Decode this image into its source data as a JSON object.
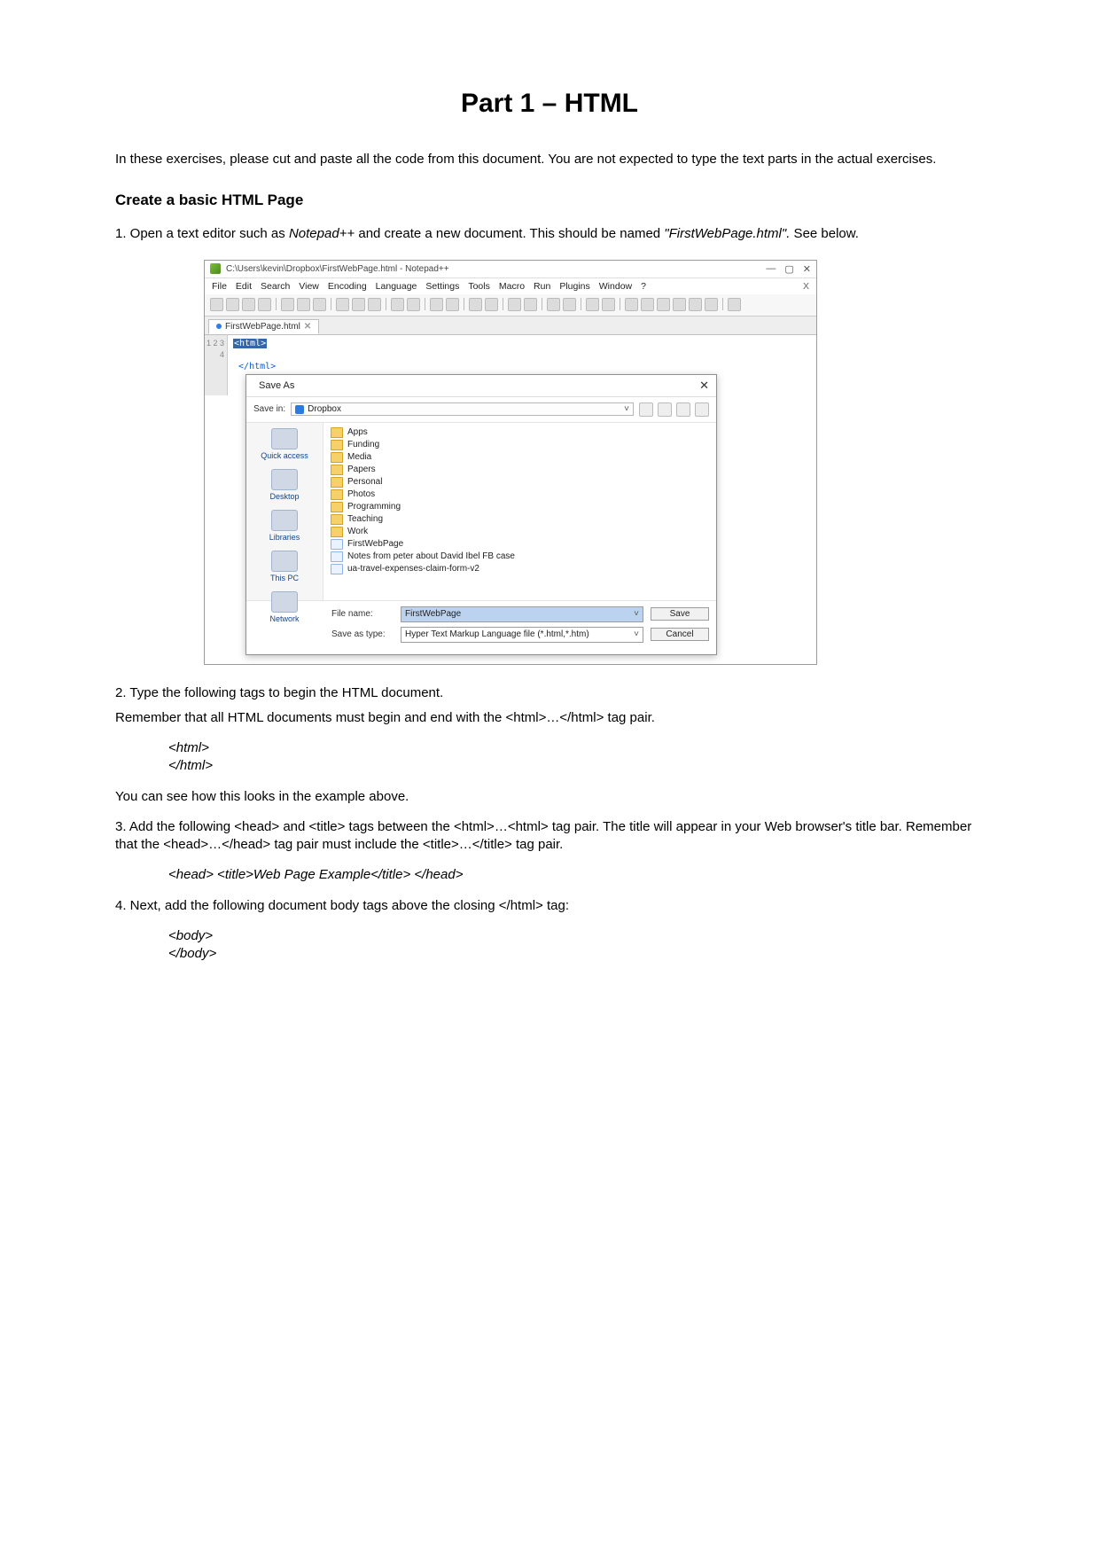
{
  "title": "Part 1 – HTML",
  "intro": "In these exercises, please cut and paste all the code from this document. You are not expected to type the text parts in the actual exercises.",
  "heading1": "Create a basic HTML Page",
  "step1_a": "1. Open a text editor such as ",
  "step1_b": "Notepad++",
  "step1_c": " and create a new document. This should be named ",
  "step1_d": "\"FirstWebPage.html\".",
  "step1_e": " See below.",
  "npp": {
    "title": "C:\\Users\\kevin\\Dropbox\\FirstWebPage.html - Notepad++",
    "win_min": "—",
    "win_max": "▢",
    "win_close": "✕",
    "menu": [
      "File",
      "Edit",
      "Search",
      "View",
      "Encoding",
      "Language",
      "Settings",
      "Tools",
      "Macro",
      "Run",
      "Plugins",
      "Window",
      "?"
    ],
    "menu_x": "X",
    "tab_label": "FirstWebPage.html",
    "tab_close": "✕",
    "gutter": "1\n2\n3\n4",
    "code_line1": "<html>",
    "code_line2": "</html>"
  },
  "saveas": {
    "title": "Save As",
    "close": "✕",
    "save_in_label": "Save in:",
    "save_in_value": "Dropbox",
    "dropdown_arrow": "˅",
    "places": [
      "Quick access",
      "Desktop",
      "Libraries",
      "This PC",
      "Network"
    ],
    "files": [
      {
        "name": "Apps",
        "type": "folder"
      },
      {
        "name": "Funding",
        "type": "folder"
      },
      {
        "name": "Media",
        "type": "folder"
      },
      {
        "name": "Papers",
        "type": "folder"
      },
      {
        "name": "Personal",
        "type": "folder"
      },
      {
        "name": "Photos",
        "type": "folder"
      },
      {
        "name": "Programming",
        "type": "folder"
      },
      {
        "name": "Teaching",
        "type": "folder"
      },
      {
        "name": "Work",
        "type": "folder"
      },
      {
        "name": "FirstWebPage",
        "type": "file"
      },
      {
        "name": "Notes from peter about David Ibel FB case",
        "type": "file"
      },
      {
        "name": "ua-travel-expenses-claim-form-v2",
        "type": "file"
      }
    ],
    "filename_label": "File name:",
    "filename_value": "FirstWebPage",
    "savetype_label": "Save as type:",
    "savetype_value": "Hyper Text Markup Language file (*.html,*.htm)",
    "save_btn": "Save",
    "cancel_btn": "Cancel"
  },
  "step2_a": "2. Type the following tags to begin the HTML document.",
  "step2_b": "Remember that all HTML documents must begin and end with the <html>…</html> tag pair.",
  "code1_l1": "<html>",
  "code1_l2": "</html>",
  "step2_c": "You can see how this looks in the example above.",
  "step3": "3. Add the following <head> and <title> tags between the <html>…<html> tag pair. The title will appear in your Web browser's title bar. Remember that the <head>…</head> tag pair must include the <title>…</title> tag pair.",
  "code2": "<head> <title>Web Page Example</title> </head>",
  "step4": "4. Next, add the following document body tags above the closing </html> tag:",
  "code3_l1": "<body>",
  "code3_l2": "</body>"
}
